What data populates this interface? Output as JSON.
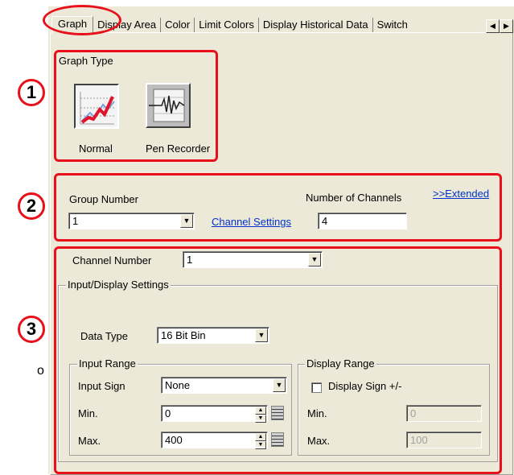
{
  "tabs": [
    {
      "label": "Graph"
    },
    {
      "label": "Display Area"
    },
    {
      "label": "Color"
    },
    {
      "label": "Limit Colors"
    },
    {
      "label": "Display Historical Data"
    },
    {
      "label": "Switch"
    }
  ],
  "graph_type": {
    "title": "Graph Type",
    "options": [
      {
        "label": "Normal",
        "icon": "line-graph-icon",
        "selected": true
      },
      {
        "label": "Pen Recorder",
        "icon": "pen-recorder-icon",
        "selected": false
      }
    ]
  },
  "group": {
    "label": "Group Number",
    "value": "1",
    "channel_settings_link": "Channel Settings",
    "channels_label": "Number of Channels",
    "channels_value": "4",
    "extended_link": ">>Extended"
  },
  "channel": {
    "label": "Channel Number",
    "value": "1",
    "settings_group_title": "Input/Display Settings",
    "data_type_label": "Data Type",
    "data_type_value": "16 Bit Bin",
    "input_range": {
      "title": "Input Range",
      "sign_label": "Input Sign",
      "sign_value": "None",
      "min_label": "Min.",
      "min_value": "0",
      "max_label": "Max.",
      "max_value": "400"
    },
    "display_range": {
      "title": "Display Range",
      "sign_label": "Display Sign +/-",
      "sign_checked": false,
      "min_label": "Min.",
      "min_value": "0",
      "max_label": "Max.",
      "max_value": "100"
    }
  },
  "annotations": [
    {
      "label": "1"
    },
    {
      "label": "2"
    },
    {
      "label": "3"
    }
  ],
  "side_text": "o",
  "colors": {
    "annotation_red": "#e8101a",
    "dialog_bg": "#ece9d8",
    "link_blue": "#0033cc"
  }
}
